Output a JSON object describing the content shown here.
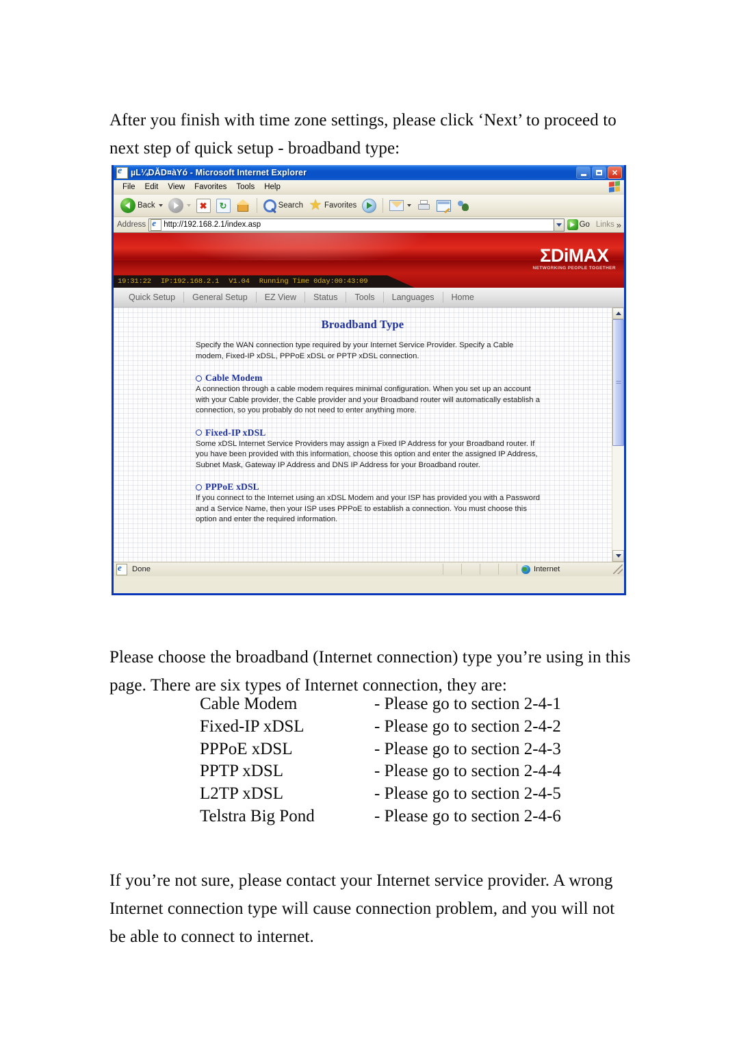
{
  "document": {
    "intro_paragraph": "After you finish with time zone settings, please click ‘Next’ to proceed to next step of quick setup - broadband type:",
    "choose_paragraph": "Please choose the broadband (Internet connection) type you’re using in this page. There are six types of Internet connection, they are:",
    "closing_paragraph": "If you’re not sure, please contact your Internet service provider. A wrong Internet connection type will cause connection problem, and you will not be able to connect to internet.",
    "connection_types": [
      {
        "type": "Cable Modem",
        "reference": "- Please go to section 2-4-1"
      },
      {
        "type": "Fixed-IP xDSL",
        "reference": "- Please go to section 2-4-2"
      },
      {
        "type": "PPPoE xDSL",
        "reference": "- Please go to section 2-4-3"
      },
      {
        "type": "PPTP xDSL",
        "reference": "- Please go to section 2-4-4"
      },
      {
        "type": "L2TP xDSL",
        "reference": "- Please go to section 2-4-5"
      },
      {
        "type": "Telstra Big Pond",
        "reference": "- Please go to section 2-4-6"
      }
    ]
  },
  "browser": {
    "title": "µL¼DĂD¤àYó - Microsoft Internet Explorer",
    "window_buttons": {
      "minimize": "Minimize",
      "maximize": "Maximize",
      "close": "✕"
    },
    "menu": [
      "File",
      "Edit",
      "View",
      "Favorites",
      "Tools",
      "Help"
    ],
    "toolbar": {
      "back_label": "Back",
      "forward_label": "Forward",
      "stop_label": "✖",
      "refresh_label": "↻",
      "search_label": "Search",
      "favorites_label": "Favorites"
    },
    "address": {
      "label": "Address",
      "value": "http://192.168.2.1/index.asp",
      "go_label": "Go",
      "links_label": "Links",
      "chevron": "»"
    },
    "statusbar": {
      "status_text": "Done",
      "zone_text": "Internet"
    }
  },
  "router": {
    "brand": {
      "name": "ΣDiMAX",
      "tagline": "NETWORKING PEOPLE TOGETHER"
    },
    "statusline": {
      "time": "19:31:22",
      "ip": "IP:192.168.2.1",
      "version": "V1.04",
      "uptime": "Running Time 0day:00:43:09"
    },
    "nav": [
      "Quick Setup",
      "General Setup",
      "EZ View",
      "Status",
      "Tools",
      "Languages",
      "Home"
    ],
    "page": {
      "title": "Broadband Type",
      "intro": "Specify the WAN connection type required by your Internet Service Provider. Specify a Cable modem, Fixed-IP xDSL, PPPoE xDSL or PPTP xDSL connection.",
      "options": [
        {
          "label": "Cable Modem",
          "description": "A connection through a cable modem requires minimal configuration. When you set up an account with your Cable provider, the Cable provider and your Broadband router will automatically establish a connection, so you probably do not need to enter anything more."
        },
        {
          "label": "Fixed-IP xDSL",
          "description": "Some xDSL Internet Service Providers may assign a Fixed IP Address for your Broadband router. If you have been provided with this information, choose this option and enter the assigned IP Address, Subnet Mask, Gateway IP Address and DNS IP Address for your Broadband router."
        },
        {
          "label": "PPPoE xDSL",
          "description": "If you connect to the Internet using an xDSL Modem and your ISP has provided you with a Password and a Service Name, then your ISP uses PPPoE to establish a connection. You must choose this option and enter the required information."
        }
      ]
    }
  }
}
